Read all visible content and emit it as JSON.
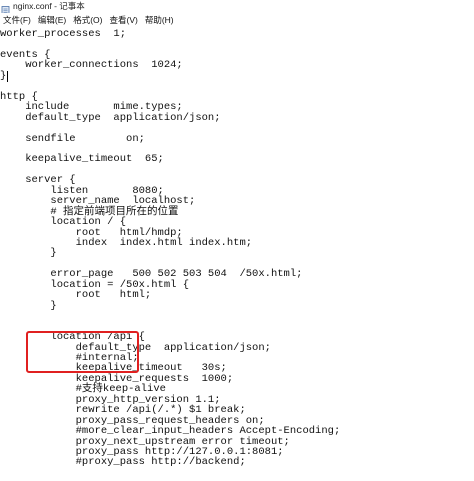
{
  "window": {
    "title": "nginx.conf - 记事本",
    "icon": "notepad-icon"
  },
  "menu": [
    {
      "label": "文件(F)"
    },
    {
      "label": "编辑(E)"
    },
    {
      "label": "格式(O)"
    },
    {
      "label": "查看(V)"
    },
    {
      "label": "帮助(H)"
    }
  ],
  "editor": {
    "lines": [
      "worker_processes  1;",
      "",
      "events {",
      "    worker_connections  1024;",
      "}",
      "",
      "http {",
      "    include       mime.types;",
      "    default_type  application/json;",
      "",
      "    sendfile        on;",
      "",
      "    keepalive_timeout  65;",
      "",
      "    server {",
      "        listen       8080;",
      "        server_name  localhost;",
      "        # 指定前端项目所在的位置",
      "        location / {",
      "            root   html/hmdp;",
      "            index  index.html index.htm;",
      "        }",
      "",
      "        error_page   500 502 503 504  /50x.html;",
      "        location = /50x.html {",
      "            root   html;",
      "        }",
      "",
      "",
      "        location /api {",
      "            default_type  application/json;",
      "            #internal;",
      "            keepalive_timeout   30s;",
      "            keepalive_requests  1000;",
      "            #支持keep-alive",
      "            proxy_http_version 1.1;",
      "            rewrite /api(/.*) $1 break;",
      "            proxy_pass_request_headers on;",
      "            #more_clear_input_headers Accept-Encoding;",
      "            proxy_next_upstream error timeout;",
      "            proxy_pass http://127.0.0.1:8081;",
      "            #proxy_pass http://backend;"
    ]
  },
  "annotation": {
    "color": "#e02020"
  }
}
